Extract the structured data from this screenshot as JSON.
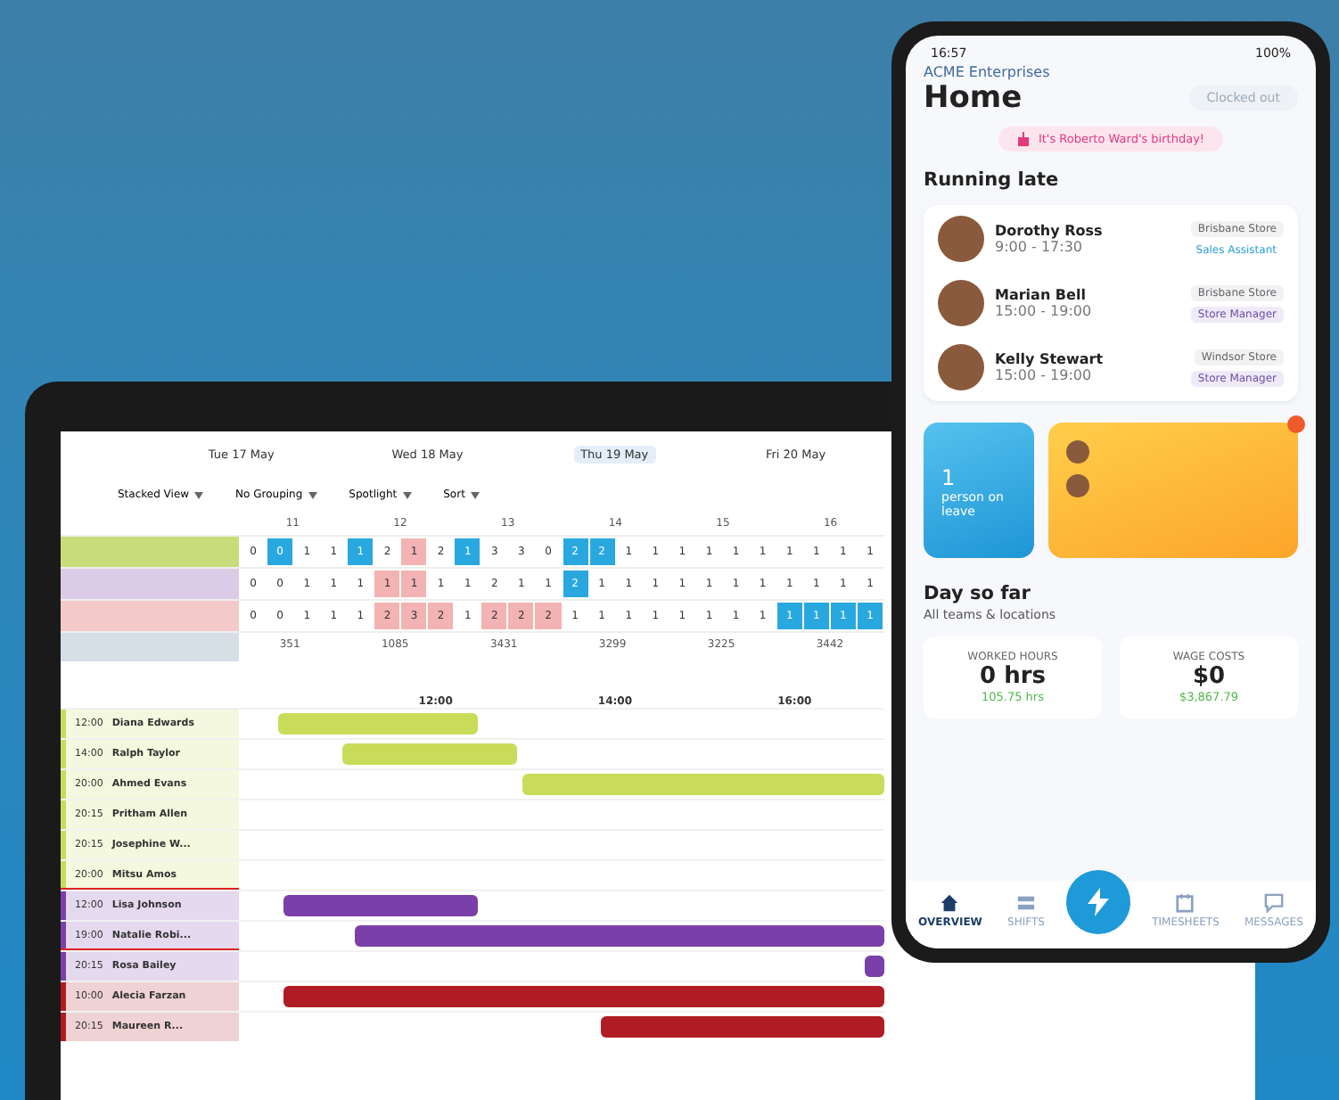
{
  "tablet": {
    "days": [
      {
        "label": "Tue 17 May",
        "selected": false
      },
      {
        "label": "Wed 18 May",
        "selected": false
      },
      {
        "label": "Thu 19 May",
        "selected": true
      },
      {
        "label": "Fri 20 May",
        "selected": false
      }
    ],
    "toolbar": [
      "Stacked View",
      "No Grouping",
      "Spotlight",
      "Sort"
    ],
    "hours": [
      "11",
      "12",
      "13",
      "14",
      "15",
      "16"
    ],
    "teams": [
      {
        "color": "#c9dc7a",
        "cells": [
          {
            "value": "0",
            "kind": "plain"
          },
          {
            "value": "0",
            "kind": "under"
          },
          {
            "value": "1",
            "kind": "plain"
          },
          {
            "value": "1",
            "kind": "plain"
          },
          {
            "value": "1",
            "kind": "under"
          },
          {
            "value": "2",
            "kind": "plain"
          },
          {
            "value": "1",
            "kind": "over"
          },
          {
            "value": "2",
            "kind": "plain"
          },
          {
            "value": "1",
            "kind": "under"
          },
          {
            "value": "3",
            "kind": "plain"
          },
          {
            "value": "3",
            "kind": "plain"
          },
          {
            "value": "0",
            "kind": "plain"
          },
          {
            "value": "2",
            "kind": "under"
          },
          {
            "value": "2",
            "kind": "under"
          },
          {
            "value": "1",
            "kind": "plain"
          },
          {
            "value": "1",
            "kind": "plain"
          },
          {
            "value": "1",
            "kind": "plain"
          },
          {
            "value": "1",
            "kind": "plain"
          },
          {
            "value": "1",
            "kind": "plain"
          },
          {
            "value": "1",
            "kind": "plain"
          },
          {
            "value": "1",
            "kind": "plain"
          },
          {
            "value": "1",
            "kind": "plain"
          },
          {
            "value": "1",
            "kind": "plain"
          },
          {
            "value": "1",
            "kind": "plain"
          }
        ]
      },
      {
        "color": "#dccbe6",
        "cells": [
          {
            "value": "0",
            "kind": "plain"
          },
          {
            "value": "0",
            "kind": "plain"
          },
          {
            "value": "1",
            "kind": "plain"
          },
          {
            "value": "1",
            "kind": "plain"
          },
          {
            "value": "1",
            "kind": "plain"
          },
          {
            "value": "1",
            "kind": "over"
          },
          {
            "value": "1",
            "kind": "over"
          },
          {
            "value": "1",
            "kind": "plain"
          },
          {
            "value": "1",
            "kind": "plain"
          },
          {
            "value": "2",
            "kind": "plain"
          },
          {
            "value": "1",
            "kind": "plain"
          },
          {
            "value": "1",
            "kind": "plain"
          },
          {
            "value": "2",
            "kind": "under"
          },
          {
            "value": "1",
            "kind": "plain"
          },
          {
            "value": "1",
            "kind": "plain"
          },
          {
            "value": "1",
            "kind": "plain"
          },
          {
            "value": "1",
            "kind": "plain"
          },
          {
            "value": "1",
            "kind": "plain"
          },
          {
            "value": "1",
            "kind": "plain"
          },
          {
            "value": "1",
            "kind": "plain"
          },
          {
            "value": "1",
            "kind": "plain"
          },
          {
            "value": "1",
            "kind": "plain"
          },
          {
            "value": "1",
            "kind": "plain"
          },
          {
            "value": "1",
            "kind": "plain"
          }
        ]
      },
      {
        "color": "#f3c9c9",
        "cells": [
          {
            "value": "0",
            "kind": "plain"
          },
          {
            "value": "0",
            "kind": "plain"
          },
          {
            "value": "1",
            "kind": "plain"
          },
          {
            "value": "1",
            "kind": "plain"
          },
          {
            "value": "1",
            "kind": "plain"
          },
          {
            "value": "2",
            "kind": "over"
          },
          {
            "value": "3",
            "kind": "over"
          },
          {
            "value": "2",
            "kind": "over"
          },
          {
            "value": "1",
            "kind": "plain"
          },
          {
            "value": "2",
            "kind": "over"
          },
          {
            "value": "2",
            "kind": "over"
          },
          {
            "value": "2",
            "kind": "over"
          },
          {
            "value": "1",
            "kind": "plain"
          },
          {
            "value": "1",
            "kind": "plain"
          },
          {
            "value": "1",
            "kind": "plain"
          },
          {
            "value": "1",
            "kind": "plain"
          },
          {
            "value": "1",
            "kind": "plain"
          },
          {
            "value": "1",
            "kind": "plain"
          },
          {
            "value": "1",
            "kind": "plain"
          },
          {
            "value": "1",
            "kind": "plain"
          },
          {
            "value": "1",
            "kind": "under"
          },
          {
            "value": "1",
            "kind": "under"
          },
          {
            "value": "1",
            "kind": "under"
          },
          {
            "value": "1",
            "kind": "under"
          }
        ]
      }
    ],
    "totals": [
      "351",
      "1085",
      "3431",
      "3299",
      "3225",
      "3442"
    ],
    "markers": [
      "12:00",
      "14:00",
      "16:00"
    ],
    "staff": [
      {
        "time": "12:00",
        "name": "Diana Edwards",
        "color": "#c9dc5a",
        "late": false
      },
      {
        "time": "14:00",
        "name": "Ralph Taylor",
        "color": "#c9dc5a",
        "late": false
      },
      {
        "time": "20:00",
        "name": "Ahmed Evans",
        "color": "#c9dc5a",
        "late": false
      },
      {
        "time": "20:15",
        "name": "Pritham Allen",
        "color": "#c9dc5a",
        "late": false
      },
      {
        "time": "20:15",
        "name": "Josephine W...",
        "color": "#c9dc5a",
        "late": false
      },
      {
        "time": "20:00",
        "name": "Mitsu Amos",
        "color": "#c9dc5a",
        "late": true
      },
      {
        "time": "12:00",
        "name": "Lisa Johnson",
        "color": "#7a3fa8",
        "late": false
      },
      {
        "time": "19:00",
        "name": "Natalie Robi...",
        "color": "#7a3fa8",
        "late": true
      },
      {
        "time": "20:15",
        "name": "Rosa Bailey",
        "color": "#7a3fa8",
        "late": false
      },
      {
        "time": "10:00",
        "name": "Alecia Farzan",
        "color": "#b01c24",
        "late": false
      },
      {
        "time": "20:15",
        "name": "Maureen R...",
        "color": "#b01c24",
        "late": false
      }
    ]
  },
  "phone": {
    "clock": "16:57",
    "battery": "100%",
    "company": "ACME Enterprises",
    "title": "Home",
    "clock_status": "Clocked out",
    "banner": "It's Roberto Ward's birthday!",
    "late_heading": "Running late",
    "late": [
      {
        "name": "Dorothy Ross",
        "hours": "9:00 - 17:30",
        "store": "Brisbane Store",
        "role": "Sales Assistant",
        "kind": "sales"
      },
      {
        "name": "Marian Bell",
        "hours": "15:00 - 19:00",
        "store": "Brisbane Store",
        "role": "Store Manager",
        "kind": "manager"
      },
      {
        "name": "Kelly Stewart",
        "hours": "15:00 - 19:00",
        "store": "Windsor Store",
        "role": "Store Manager",
        "kind": "manager"
      }
    ],
    "leave": {
      "count": "1",
      "label": "person on leave"
    },
    "day_heading": "Day so far",
    "day_sub": "All teams & locations",
    "stats": [
      {
        "label": "WORKED HOURS",
        "value": "0 hrs",
        "delta": "105.75 hrs"
      },
      {
        "label": "WAGE COSTS",
        "value": "$0",
        "delta": "$3,867.79"
      }
    ],
    "nav": [
      {
        "label": "OVERVIEW",
        "selected": true,
        "kind": "home"
      },
      {
        "label": "SHIFTS",
        "selected": false,
        "kind": "shifts"
      },
      {
        "label": "TIMESHEETS",
        "selected": false,
        "kind": "timesheets"
      },
      {
        "label": "MESSAGES",
        "selected": false,
        "kind": "messages"
      }
    ]
  }
}
